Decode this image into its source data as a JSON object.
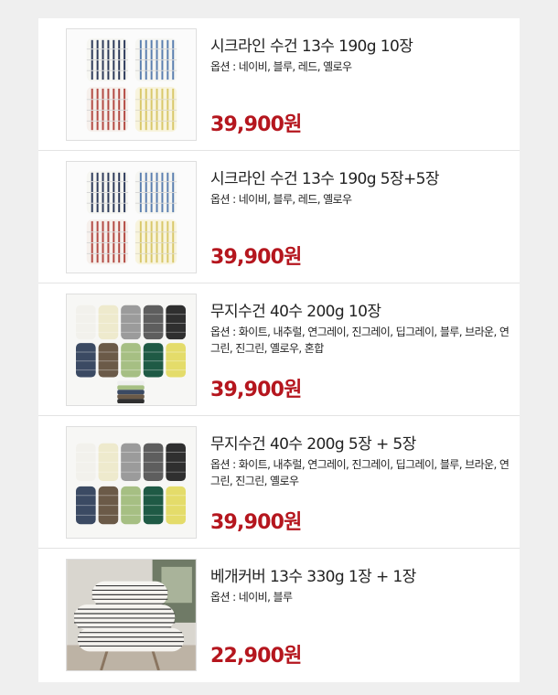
{
  "products": [
    {
      "title": "시크라인 수건 13수 190g 10장",
      "options": "옵션 : 네이비, 블루, 레드, 옐로우",
      "price": "39,900원",
      "image": "striped-towel-stacks"
    },
    {
      "title": "시크라인 수건 13수 190g 5장+5장",
      "options": "옵션 : 네이비, 블루, 레드, 옐로우",
      "price": "39,900원",
      "image": "striped-towel-stacks"
    },
    {
      "title": "무지수건 40수 200g 10장",
      "options": "옵션 : 화이트, 내추럴, 연그레이, 진그레이, 딥그레이, 블루, 브라운, 연그린, 진그린, 옐로우, 혼합",
      "price": "39,900원",
      "image": "solid-towel-stacks"
    },
    {
      "title": "무지수건 40수 200g 5장 + 5장",
      "options": "옵션 : 화이트, 내추럴, 연그레이, 진그레이, 딥그레이, 블루, 브라운, 연그린, 진그린, 옐로우",
      "price": "39,900원",
      "image": "solid-towel-stacks"
    },
    {
      "title": "베개커버 13수 330g 1장 + 1장",
      "options": "옵션 : 네이비, 블루",
      "price": "22,900원",
      "image": "striped-pillows"
    }
  ],
  "colors": {
    "price": "#b5161e",
    "stripe_navy": "#2d3a5a",
    "stripe_blue": "#5b7fb0",
    "stripe_red": "#b34a43",
    "stripe_yellow": "#d9c86a"
  }
}
